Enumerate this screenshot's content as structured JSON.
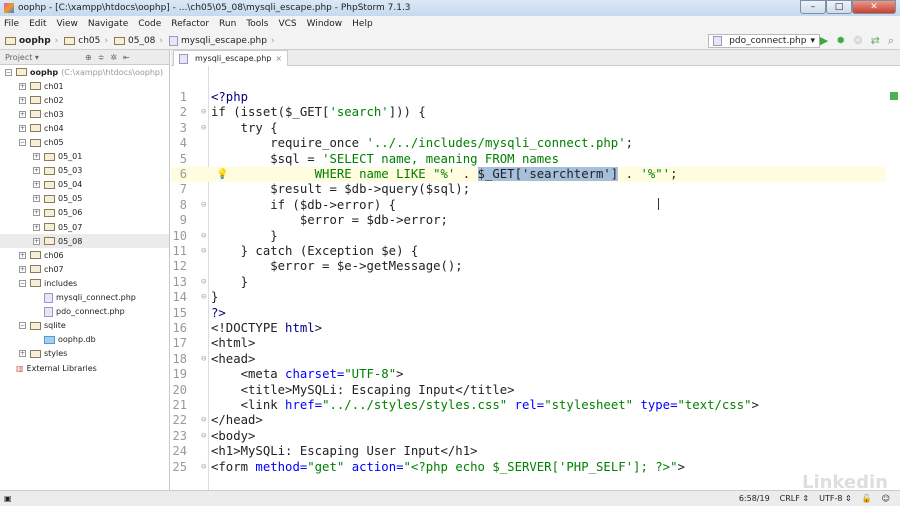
{
  "window": {
    "title": "oophp - [C:\\xampp\\htdocs\\oophp] - ...\\ch05\\05_08\\mysqli_escape.php - PhpStorm 7.1.3"
  },
  "menu": [
    "File",
    "Edit",
    "View",
    "Navigate",
    "Code",
    "Refactor",
    "Run",
    "Tools",
    "VCS",
    "Window",
    "Help"
  ],
  "breadcrumb": [
    "oophp",
    "ch05",
    "05_08",
    "mysqli_escape.php"
  ],
  "run_config": "pdo_connect.php",
  "project_panel": {
    "label": "Project"
  },
  "tree": [
    {
      "label": "oophp",
      "path": "(C:\\xampp\\htdocs\\oophp)",
      "depth": 0,
      "type": "folder",
      "exp": "-"
    },
    {
      "label": "ch01",
      "depth": 1,
      "type": "folder",
      "exp": "+"
    },
    {
      "label": "ch02",
      "depth": 1,
      "type": "folder",
      "exp": "+"
    },
    {
      "label": "ch03",
      "depth": 1,
      "type": "folder",
      "exp": "+"
    },
    {
      "label": "ch04",
      "depth": 1,
      "type": "folder",
      "exp": "+"
    },
    {
      "label": "ch05",
      "depth": 1,
      "type": "folder",
      "exp": "-"
    },
    {
      "label": "05_01",
      "depth": 2,
      "type": "folder",
      "exp": "+"
    },
    {
      "label": "05_03",
      "depth": 2,
      "type": "folder",
      "exp": "+"
    },
    {
      "label": "05_04",
      "depth": 2,
      "type": "folder",
      "exp": "+"
    },
    {
      "label": "05_05",
      "depth": 2,
      "type": "folder",
      "exp": "+"
    },
    {
      "label": "05_06",
      "depth": 2,
      "type": "folder",
      "exp": "+"
    },
    {
      "label": "05_07",
      "depth": 2,
      "type": "folder",
      "exp": "+"
    },
    {
      "label": "05_08",
      "depth": 2,
      "type": "folder",
      "exp": "+",
      "selected": true
    },
    {
      "label": "ch06",
      "depth": 1,
      "type": "folder",
      "exp": "+"
    },
    {
      "label": "ch07",
      "depth": 1,
      "type": "folder",
      "exp": "+"
    },
    {
      "label": "includes",
      "depth": 1,
      "type": "folder",
      "exp": "-"
    },
    {
      "label": "mysqli_connect.php",
      "depth": 2,
      "type": "php"
    },
    {
      "label": "pdo_connect.php",
      "depth": 2,
      "type": "php"
    },
    {
      "label": "sqlite",
      "depth": 1,
      "type": "folder",
      "exp": "-"
    },
    {
      "label": "oophp.db",
      "depth": 2,
      "type": "db"
    },
    {
      "label": "styles",
      "depth": 1,
      "type": "folder",
      "exp": "+"
    },
    {
      "label": "External Libraries",
      "depth": 0,
      "type": "lib"
    }
  ],
  "editor_tab": "mysqli_escape.php",
  "code": [
    [
      [
        "<?php",
        "k"
      ]
    ],
    [
      [
        "if (isset($_GET[",
        ""
      ],
      [
        "'search'",
        "s"
      ],
      [
        "])) {",
        ""
      ]
    ],
    [
      [
        "    try {",
        ""
      ]
    ],
    [
      [
        "        require_once ",
        ""
      ],
      [
        "'../../includes/mysqli_connect.php'",
        "s"
      ],
      [
        ";",
        ""
      ]
    ],
    [
      [
        "        $sql = ",
        ""
      ],
      [
        "'SELECT name, meaning FROM names",
        "s"
      ]
    ],
    [
      [
        "              ",
        ""
      ],
      [
        "WHERE name LIKE \"%'",
        "s"
      ],
      [
        " . ",
        ""
      ],
      [
        "$_GET['searchterm']",
        "sel"
      ],
      [
        " . ",
        ""
      ],
      [
        "'%\"'",
        "s"
      ],
      [
        ";",
        ""
      ]
    ],
    [
      [
        "        $result = $db->query($sql);",
        ""
      ]
    ],
    [
      [
        "        if ($db->error) {",
        ""
      ]
    ],
    [
      [
        "            $error = $db->error;",
        ""
      ]
    ],
    [
      [
        "        }",
        ""
      ]
    ],
    [
      [
        "    } catch (Exception $e) {",
        ""
      ]
    ],
    [
      [
        "        $error = $e->getMessage();",
        ""
      ]
    ],
    [
      [
        "    }",
        ""
      ]
    ],
    [
      [
        "}",
        ""
      ]
    ],
    [
      [
        "?>",
        "k"
      ]
    ],
    [
      [
        "<!DOCTYPE ",
        ""
      ],
      [
        "html",
        "k"
      ],
      [
        ">",
        ""
      ]
    ],
    [
      [
        "<html>",
        ""
      ]
    ],
    [
      [
        "<head>",
        ""
      ]
    ],
    [
      [
        "    <meta ",
        ""
      ],
      [
        "charset=",
        "a"
      ],
      [
        "\"UTF-8\"",
        "s"
      ],
      [
        ">",
        ""
      ]
    ],
    [
      [
        "    <title>MySQLi: Escaping Input</title>",
        ""
      ]
    ],
    [
      [
        "    <link ",
        ""
      ],
      [
        "href=",
        "a"
      ],
      [
        "\"../../styles/styles.css\"",
        "s"
      ],
      [
        " ",
        ""
      ],
      [
        "rel=",
        "a"
      ],
      [
        "\"stylesheet\"",
        "s"
      ],
      [
        " ",
        ""
      ],
      [
        "type=",
        "a"
      ],
      [
        "\"text/css\"",
        "s"
      ],
      [
        ">",
        ""
      ]
    ],
    [
      [
        "</head>",
        ""
      ]
    ],
    [
      [
        "<body>",
        ""
      ]
    ],
    [
      [
        "<h1>MySQLi: Escaping User Input</h1>",
        ""
      ]
    ],
    [
      [
        "<form ",
        ""
      ],
      [
        "method=",
        "a"
      ],
      [
        "\"get\"",
        "s"
      ],
      [
        " ",
        ""
      ],
      [
        "action=",
        "a"
      ],
      [
        "\"<?php echo $_SERVER[",
        "s"
      ],
      [
        "'PHP_SELF'",
        "s"
      ],
      [
        "]; ?>\"",
        "s"
      ],
      [
        ">",
        ""
      ]
    ]
  ],
  "status": {
    "position": "6:58/19",
    "line_sep": "CRLF",
    "encoding": "UTF-8"
  },
  "watermark": "Linked in"
}
